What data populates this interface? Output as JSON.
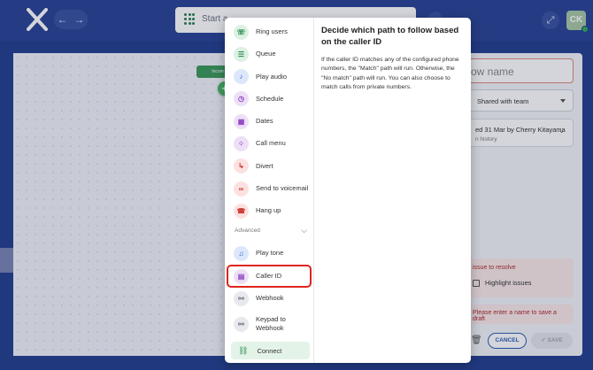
{
  "topbar": {
    "search_text": "Start a",
    "back_icon": "←",
    "forward_icon": "→",
    "avatar_initials": "CK"
  },
  "editor": {
    "start_node_label": "Incom",
    "flow_name_placeholder": "flow name",
    "visibility_value": "Shared with team",
    "history_line1": "ed 31 Mar by Cherry Kitayama",
    "history_line2": "n history",
    "issue_title": "issue to resolve",
    "highlight_issues_label": "Highlight issues",
    "error_message": "Please enter a name to save a draft",
    "cancel_label": "CANCEL",
    "save_label": "SAVE"
  },
  "menu": {
    "items": [
      {
        "label": "Ring users",
        "icon": "ring-users-icon",
        "color": "green"
      },
      {
        "label": "Queue",
        "icon": "queue-icon",
        "color": "green"
      },
      {
        "label": "Play audio",
        "icon": "play-audio-icon",
        "color": "blue"
      },
      {
        "label": "Schedule",
        "icon": "clock-icon",
        "color": "purple"
      },
      {
        "label": "Dates",
        "icon": "calendar-icon",
        "color": "purple"
      },
      {
        "label": "Call menu",
        "icon": "dialpad-icon",
        "color": "purple"
      },
      {
        "label": "Divert",
        "icon": "divert-icon",
        "color": "red"
      },
      {
        "label": "Send to voicemail",
        "icon": "voicemail-icon",
        "color": "red"
      },
      {
        "label": "Hang up",
        "icon": "hang-up-icon",
        "color": "red"
      }
    ],
    "advanced_label": "Advanced",
    "advanced_items": [
      {
        "label": "Play tone",
        "icon": "play-tone-icon",
        "color": "blue"
      },
      {
        "label": "Caller ID",
        "icon": "caller-id-icon",
        "color": "purple"
      },
      {
        "label": "Webhook",
        "icon": "webhook-icon",
        "color": "grey"
      },
      {
        "label": "Keypad to Webhook",
        "icon": "keypad-webhook-icon",
        "color": "grey"
      }
    ],
    "connect_label": "Connect"
  },
  "description": {
    "title": "Decide which path to follow based on the caller ID",
    "body": "If the caller ID matches any of the configured phone numbers, the \"Match\" path will run. Otherwise, the \"No match\" path will run. You can also choose to match calls from private numbers."
  }
}
